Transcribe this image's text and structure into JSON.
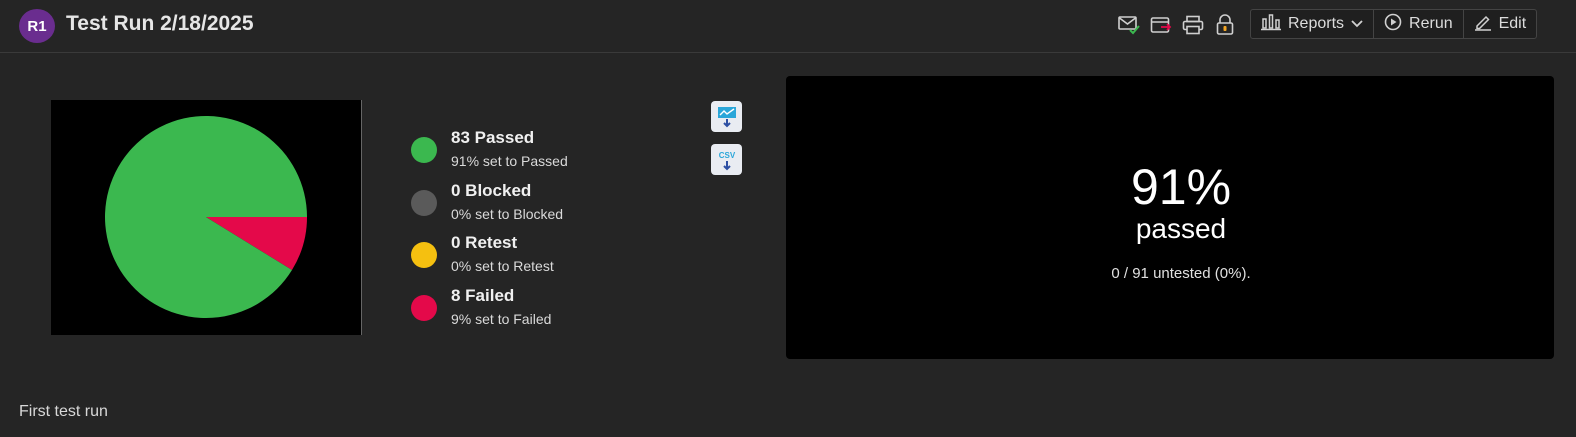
{
  "header": {
    "avatar_initials": "R1",
    "title": "Test Run 2/18/2025",
    "icons": [
      "email-check-icon",
      "move-run-icon",
      "print-icon",
      "lock-icon"
    ],
    "buttons": {
      "reports": "Reports",
      "rerun": "Rerun",
      "edit": "Edit"
    }
  },
  "legend": [
    {
      "title": "83 Passed",
      "sub": "91% set to Passed",
      "color": "#3bb84f"
    },
    {
      "title": "0 Blocked",
      "sub": "0% set to Blocked",
      "color": "#5a5a5a"
    },
    {
      "title": "0 Retest",
      "sub": "0% set to Retest",
      "color": "#f5c010"
    },
    {
      "title": "8 Failed",
      "sub": "9% set to Failed",
      "color": "#e4094a"
    }
  ],
  "exports": {
    "csv_label": "CSV"
  },
  "summary": {
    "percent": "91%",
    "label": "passed",
    "untested": "0 / 91 untested (0%)."
  },
  "description": "First test run",
  "chart_data": {
    "type": "pie",
    "categories": [
      "Passed",
      "Blocked",
      "Retest",
      "Failed"
    ],
    "values": [
      83,
      0,
      0,
      8
    ],
    "colors": [
      "#3bb84f",
      "#5a5a5a",
      "#f5c010",
      "#e4094a"
    ]
  }
}
